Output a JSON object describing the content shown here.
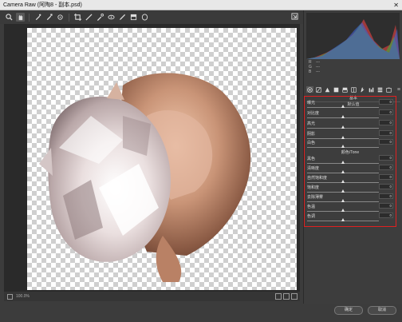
{
  "window": {
    "title": "Camera Raw (阿陶8 - 副本.psd)",
    "close_glyph": "✕"
  },
  "toolbar": {
    "tools": [
      "zoom-icon",
      "hand-icon",
      "white-balance-icon",
      "color-sampler-icon",
      "targeted-adjust-icon",
      "crop-icon",
      "straighten-icon",
      "spot-removal-icon",
      "red-eye-icon",
      "adjustment-brush-icon",
      "graduated-filter-icon",
      "radial-filter-icon"
    ],
    "toggle_icon": "fullscreen-icon"
  },
  "status": {
    "zoom": "100.0%"
  },
  "histogram": {
    "channels": [
      "R",
      "G",
      "B"
    ],
    "values": [
      "---",
      "---",
      "---"
    ]
  },
  "panel": {
    "tab_title": "基本",
    "sub_title": "默认值",
    "tabs": [
      "basic-icon",
      "tone-curve-icon",
      "detail-icon",
      "hsl-icon",
      "split-toning-icon",
      "lens-icon",
      "effects-icon",
      "calibration-icon",
      "presets-icon",
      "snapshots-icon"
    ],
    "menu_glyph": "≡",
    "group_title": "颜色/Tone",
    "sliders": [
      {
        "label": "曝光",
        "value": "0",
        "position": 0.5
      },
      {
        "label": "对比度",
        "value": "0",
        "position": 0.5
      },
      {
        "label": "高光",
        "value": "0",
        "position": 0.5
      },
      {
        "label": "阴影",
        "value": "0",
        "position": 0.5
      },
      {
        "label": "白色",
        "value": "0",
        "position": 0.5
      },
      {
        "label": "黑色",
        "value": "0",
        "position": 0.5
      },
      {
        "label": "清晰度",
        "value": "0",
        "position": 0.5
      },
      {
        "label": "自然饱和度",
        "value": "0",
        "position": 0.5
      },
      {
        "label": "饱和度",
        "value": "0",
        "position": 0.5
      },
      {
        "label": "去除薄雾",
        "value": "0",
        "position": 0.5
      },
      {
        "label": "色温",
        "value": "0",
        "position": 0.5
      },
      {
        "label": "色调",
        "value": "0",
        "position": 0.5
      }
    ]
  },
  "buttons": {
    "ok": "确定",
    "cancel": "取消"
  },
  "colors": {
    "highlight": "#e02020"
  }
}
